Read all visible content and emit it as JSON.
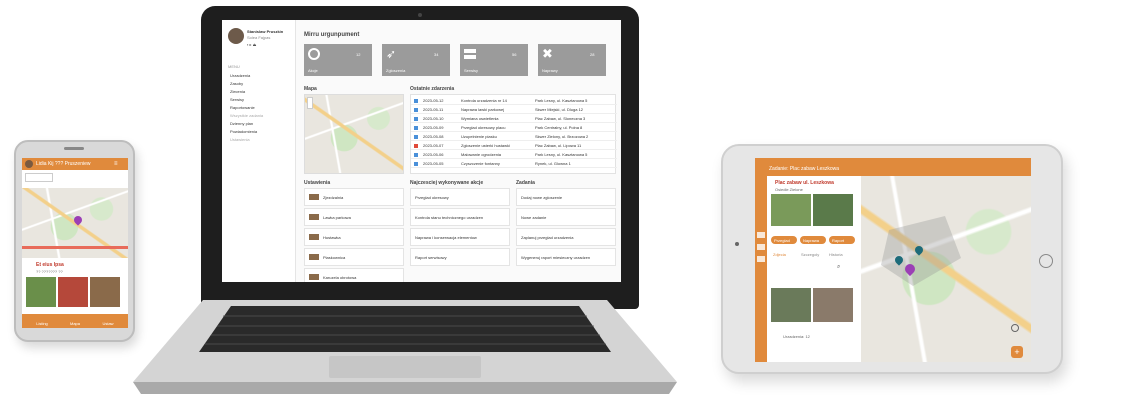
{
  "phone": {
    "header_title": "Lidia Kij ??? Pruszeniew",
    "card_title": "Et eius Ipsa",
    "card_sub": "?? ??????? ??",
    "nav_labels": [
      "Listing",
      "Mapa",
      "Ustaw"
    ]
  },
  "laptop": {
    "user_name": "Stanislaw Pruszkin",
    "user_sub": "Solea Fajpas",
    "dashboard_title": "Mirru urgunpument",
    "sidebar_section": "MENU",
    "sidebar_items": [
      "Urzadzenia",
      "Zasoby",
      "Zlecenia",
      "Serwisy",
      "Raportowanie",
      "Wszystkie zadania",
      "Dzienny plan",
      "Powiadomienia",
      "Ustawienia"
    ],
    "tiles": [
      {
        "label": "Akcje",
        "count": "12",
        "icon": "target-icon"
      },
      {
        "label": "Zgloszenia",
        "count": "34",
        "icon": "rocket-icon"
      },
      {
        "label": "Serwisy",
        "count": "56",
        "icon": "server-icon"
      },
      {
        "label": "Naprawy",
        "count": "28",
        "icon": "tools-icon"
      }
    ],
    "map_title": "Mapa",
    "events_title": "Ostatnie zdarzenia",
    "events": [
      {
        "date": "2023-05-12",
        "desc": "Kontrola urzadzenia nr 14",
        "place": "Park Lesny, ul. Kasztanowa 5"
      },
      {
        "date": "2023-05-11",
        "desc": "Naprawa lawki parkowej",
        "place": "Skwer Miejski, ul. Dluga 12"
      },
      {
        "date": "2023-05-10",
        "desc": "Wymiana oswietlenia",
        "place": "Plac Zabaw, ul. Sloneczna 3"
      },
      {
        "date": "2023-05-09",
        "desc": "Przeglad okresowy placu",
        "place": "Park Centralny, ul. Polna 8"
      },
      {
        "date": "2023-05-08",
        "desc": "Uzupelnienie piasku",
        "place": "Skwer Zielony, ul. Brzozowa 2"
      },
      {
        "date": "2023-05-07",
        "desc": "Zgloszenie usterki hustawki",
        "place": "Plac Zabaw, ul. Lipowa 11"
      },
      {
        "date": "2023-05-06",
        "desc": "Malowanie ogrodzenia",
        "place": "Park Lesny, ul. Kasztanowa 5"
      },
      {
        "date": "2023-05-05",
        "desc": "Czyszczenie fontanny",
        "place": "Rynek, ul. Glowna 1"
      }
    ],
    "col1_title": "Ustawienia",
    "col1_items": [
      "Zjezdzalnia",
      "Lawka parkowa",
      "Hustawka",
      "Piaskownica",
      "Karuzela obrotowa"
    ],
    "col2_title": "Najczesciej wykonywane akcje",
    "col2_items": [
      "Przeglad okresowy",
      "Kontrola stanu technicznego urzadzen",
      "Naprawa i konserwacja elementow",
      "Raport serwisowy"
    ],
    "col3_title": "Zadania",
    "col3_items": [
      "Dodaj nowe zgloszenie",
      "Nowe zadanie",
      "Zaplanuj przeglad urzadzenia",
      "Wygeneruj raport miesieczny urzadzen"
    ]
  },
  "tablet": {
    "header_title": "Zadanie: Plac zabaw Leszkowa",
    "card_title": "Plac zabaw ul. Leszkowa",
    "card_sub": "Osiedle Zielone",
    "chips": [
      "Przeglad",
      "Naprawa",
      "Raport"
    ],
    "tabs": [
      "Zdjecia",
      "Szczegoly",
      "Historia"
    ],
    "footer": "Urzadzenia: 12"
  },
  "colors": {
    "accent": "#e08a3c",
    "tile": "#9b9b9b",
    "pin_purple": "#9b3fb5",
    "pin_teal": "#1d6b7a"
  }
}
